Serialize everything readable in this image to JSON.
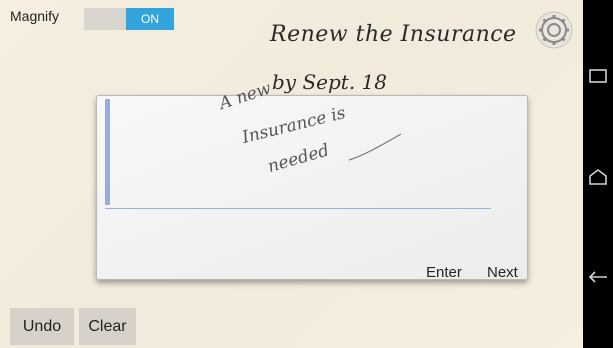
{
  "magnify": {
    "label": "Magnify",
    "toggle_state": "ON"
  },
  "notes": {
    "line1": "Renew the Insurance",
    "line2": "by Sept. 18"
  },
  "panel": {
    "ink_line1": "A new",
    "ink_line2": "Insurance is",
    "ink_line3": "needed"
  },
  "actions": {
    "enter": "Enter",
    "next": "Next",
    "undo": "Undo",
    "clear": "Clear"
  },
  "icons": {
    "settings": "gear-icon",
    "recent_apps": "recent-apps-icon",
    "home": "home-icon",
    "back": "back-icon"
  },
  "colors": {
    "toggle_on": "#33a3dc",
    "background": "#f4ede0",
    "cursor_bar": "#97aedc"
  }
}
